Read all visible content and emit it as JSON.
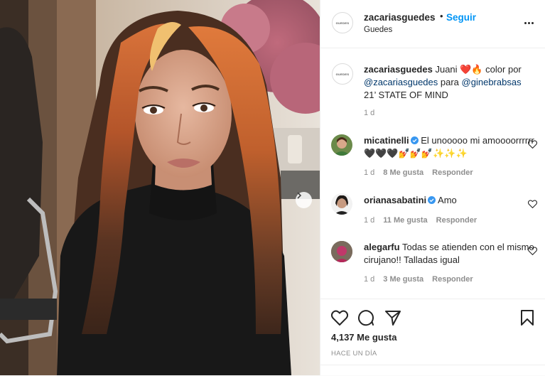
{
  "header": {
    "username": "zacariasguedes",
    "separator": "•",
    "follow_label": "Seguir",
    "location": "Guedes",
    "logo_text": "GUEDES"
  },
  "caption": {
    "username": "zacariasguedes",
    "text_start": "Juani",
    "emoji": "❤️🔥",
    "text_mid": "color por",
    "mention_1": "@zacariasguedes",
    "word_para": "para",
    "mention_2": "@ginebrabsas",
    "text_end": "21’ STATE OF MIND",
    "time": "1 d"
  },
  "comments": [
    {
      "username": "micatinelli",
      "verified": true,
      "text": "El unooooo mi amoooorrrrrr 🖤🖤🖤💅💅💅✨✨✨",
      "time": "1 d",
      "likes": "8 Me gusta",
      "reply": "Responder"
    },
    {
      "username": "orianasabatini",
      "verified": true,
      "text": "Amo",
      "time": "1 d",
      "likes": "11 Me gusta",
      "reply": "Responder"
    },
    {
      "username": "alegarfu",
      "verified": false,
      "text": "Todas se atienden con el mismo cirujano!! Talladas igual",
      "time": "1 d",
      "likes": "3 Me gusta",
      "reply": "Responder"
    }
  ],
  "footer": {
    "likes_count": "4,137 Me gusta",
    "posted": "HACE UN DÍA"
  },
  "colors": {
    "accent": "#0095f6",
    "mention": "#00376b",
    "muted": "#8e8e8e",
    "text": "#262626",
    "verified": "#3897f0"
  },
  "icons": [
    "heart-icon",
    "comment-icon",
    "share-icon",
    "bookmark-icon",
    "more-icon",
    "chevron-right-icon",
    "verified-icon"
  ]
}
